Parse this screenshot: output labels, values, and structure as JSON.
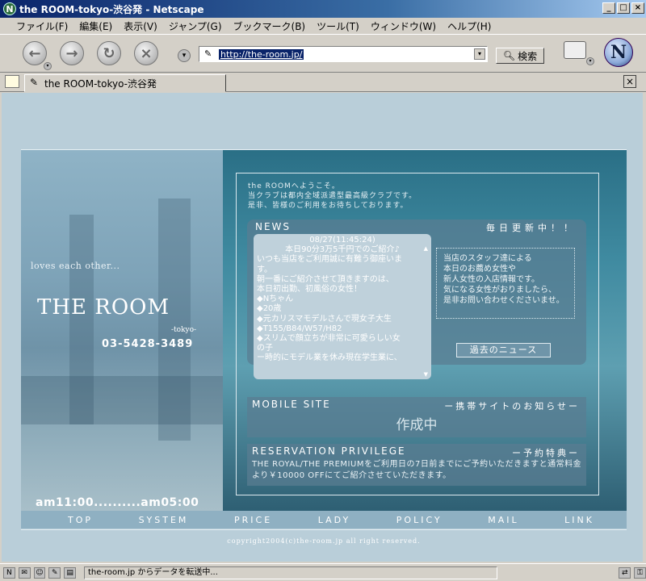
{
  "window": {
    "title": "the ROOM-tokyo-渋谷発 - Netscape"
  },
  "menu": [
    "ファイル(F)",
    "編集(E)",
    "表示(V)",
    "ジャンプ(G)",
    "ブックマーク(B)",
    "ツール(T)",
    "ウィンドウ(W)",
    "ヘルプ(H)"
  ],
  "toolbar": {
    "url": "http://the-room.jp/",
    "search_label": "検索"
  },
  "tab": {
    "title": "the ROOM-tokyo-渋谷発"
  },
  "site": {
    "tagline": "loves each other...",
    "logo": "THE ROOM",
    "logo_sub": "-tokyo-",
    "phone": "03-5428-3489",
    "hours": "am11:00..........am05:00",
    "welcome": [
      "the ROOMへようこそ。",
      "当クラブは都内全域派遣型最高級クラブです。",
      "是非、皆様のご利用をお待ちしております。"
    ],
    "news_title": "NEWS",
    "news_daily": "毎日更新中！！",
    "news_date": "08/27(11:45:24)",
    "news_headline": "本日90分3万5千円でのご紹介♪",
    "news_lines": [
      "いつも当店をご利用誠に有難う御座いま",
      "す。",
      "朝一番にご紹介させて頂きますのは、",
      "本日初出勤、初風俗の女性！",
      "◆Nちゃん",
      "◆20歳",
      "◆元カリスマモデルさんで現女子大生",
      "◆T155/B84/W57/H82",
      "◆スリムで顔立ちが非常に可愛らしい女",
      "の子",
      "ー時的にモデル業を休み現在学生業に、"
    ],
    "staff_info": [
      "当店のスタッフ達による",
      "本日のお薦め女性や",
      "新人女性の入店情報です。",
      "気になる女性がおりましたら、",
      "是非お問い合わせくださいませ。"
    ],
    "past_news_button": "過去のニュース",
    "mobile_title": "MOBILE SITE",
    "mobile_note": "ー携帯サイトのお知らせー",
    "mobile_body": "作成中",
    "reserve_title": "RESERVATION PRIVILEGE",
    "reserve_note": "ー予約特典ー",
    "reserve_body": "THE ROYAL/THE PREMIUMをご利用日の7日前までにご予約いただきますと通常料金より￥10000 OFFにてご紹介させていただきます。",
    "nav": [
      "TOP",
      "SYSTEM",
      "PRICE",
      "LADY",
      "POLICY",
      "MAIL",
      "LINK"
    ],
    "copyright": "copyright2004(c)the-room.jp all right reserved."
  },
  "status": {
    "text": "the-room.jp からデータを転送中..."
  }
}
